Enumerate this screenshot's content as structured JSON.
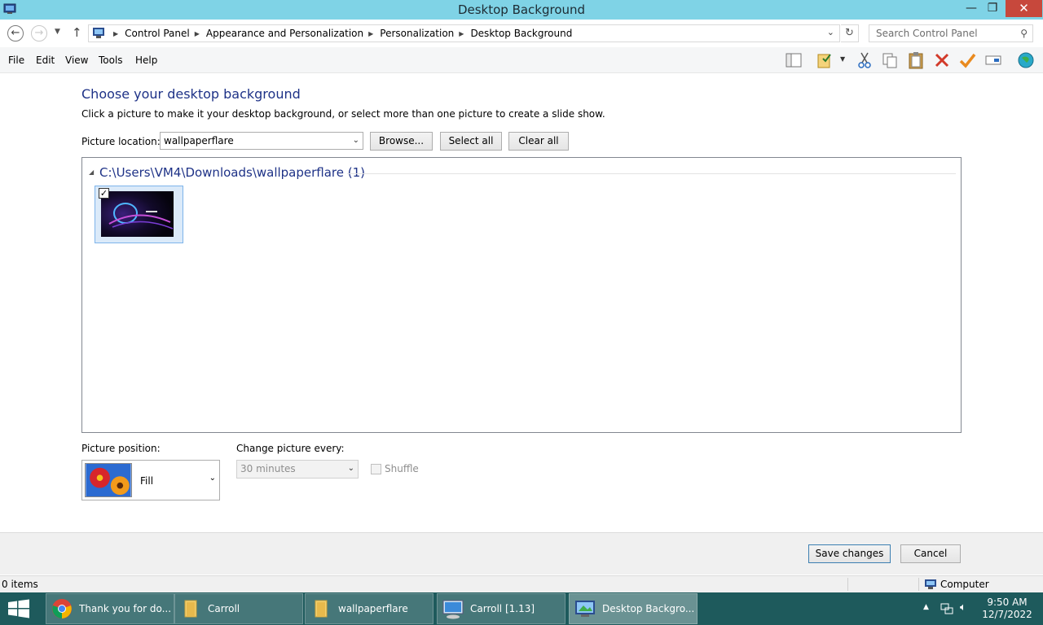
{
  "window": {
    "title": "Desktop Background",
    "minimize_glyph": "—",
    "maximize_glyph": "❐",
    "close_glyph": "✕"
  },
  "address": {
    "breadcrumbs": [
      "Control Panel",
      "Appearance and Personalization",
      "Personalization",
      "Desktop Background"
    ],
    "search_placeholder": "Search Control Panel"
  },
  "menu": [
    "File",
    "Edit",
    "View",
    "Tools",
    "Help"
  ],
  "toolbar_icons": [
    "layout-icon",
    "properties-icon",
    "cut-icon",
    "copy-icon",
    "paste-icon",
    "delete-icon",
    "check-icon",
    "rename-icon",
    "globe-icon"
  ],
  "page": {
    "heading": "Choose your desktop background",
    "subtext": "Click a picture to make it your desktop background, or select more than one picture to create a slide show.",
    "location_label": "Picture location:",
    "location_value": "wallpaperflare",
    "browse_label": "Browse...",
    "select_all_label": "Select all",
    "clear_all_label": "Clear all"
  },
  "gallery": {
    "group_title": "C:\\Users\\VM4\\Downloads\\wallpaperflare (1)",
    "items": [
      {
        "name": "wallpaper-thumbnail",
        "checked": true
      }
    ]
  },
  "options": {
    "position_label": "Picture position:",
    "position_value": "Fill",
    "change_label": "Change picture every:",
    "change_value": "30 minutes",
    "shuffle_label": "Shuffle"
  },
  "footer": {
    "save_label": "Save changes",
    "cancel_label": "Cancel"
  },
  "status": {
    "items_text": "0 items",
    "computer_text": "Computer"
  },
  "taskbar": {
    "items": [
      {
        "label": "Thank you for do...",
        "icon": "chrome-icon"
      },
      {
        "label": "Carroll",
        "icon": "folder-icon"
      },
      {
        "label": "wallpaperflare",
        "icon": "folder-icon"
      },
      {
        "label": "Carroll [1.13]",
        "icon": "remote-desktop-icon"
      },
      {
        "label": "Desktop Backgro...",
        "icon": "control-panel-icon"
      }
    ],
    "time": "9:50 AM",
    "date": "12/7/2022"
  },
  "colors": {
    "titlebar": "#7fd3e6",
    "heading": "#1e3287",
    "taskbar": "#1e5a5c",
    "close_button": "#c7483c"
  }
}
